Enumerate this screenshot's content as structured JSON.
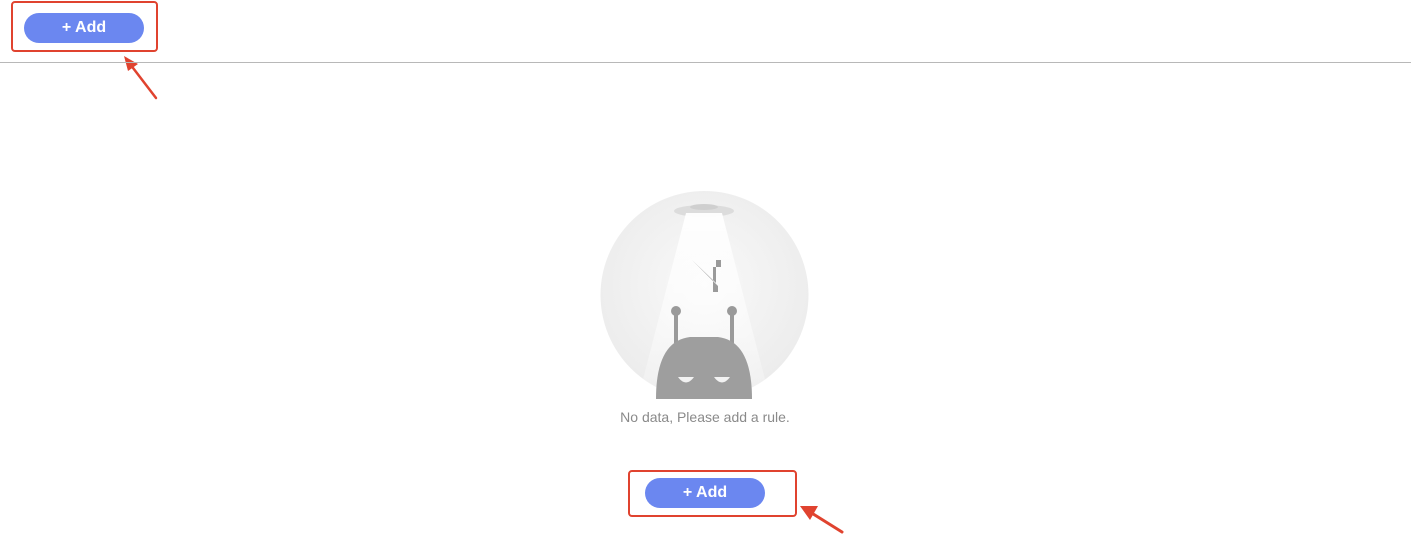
{
  "toolbar": {
    "add_label": "+ Add"
  },
  "empty_state": {
    "illustration_icon": "robot-spotlight-icon",
    "message": "No data, Please add a rule.",
    "add_label": "+ Add"
  },
  "annotations": {
    "highlight_color": "#e0432f",
    "arrow_icon": "red-pointer-arrow-icon"
  },
  "colors": {
    "button_bg": "#6b87f0",
    "button_text": "#ffffff",
    "empty_text": "#8a8a8a",
    "divider": "#b8b8b8"
  }
}
